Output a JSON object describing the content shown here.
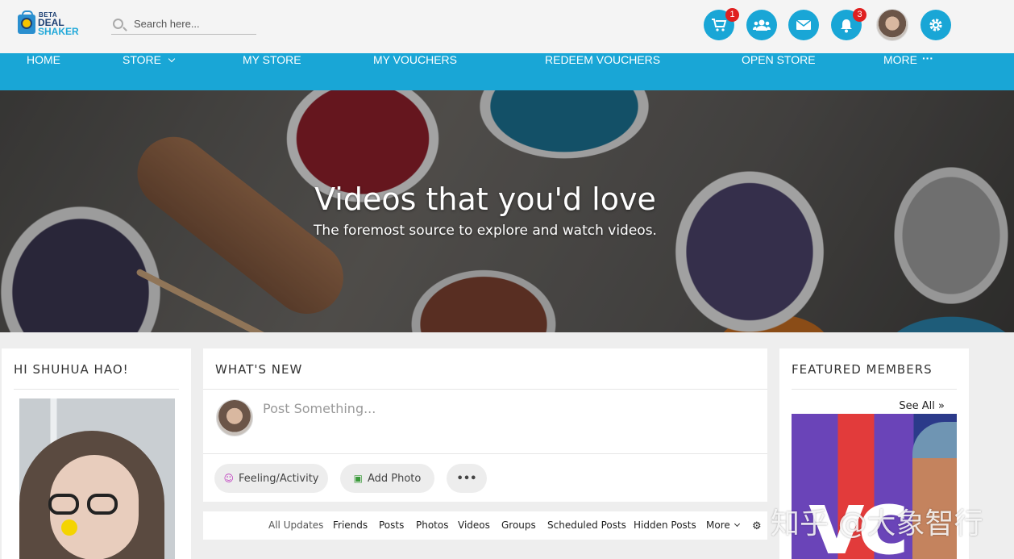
{
  "brand": {
    "line1": "BETA",
    "line2": "DEAL",
    "line3": "SHAKER"
  },
  "search": {
    "placeholder": "Search here..."
  },
  "header_icons": {
    "cart": {
      "icon": "cart-icon",
      "badge": "1"
    },
    "friends": {
      "icon": "users-icon"
    },
    "messages": {
      "icon": "envelope-icon"
    },
    "notifications": {
      "icon": "bell-icon",
      "badge": "3"
    },
    "settings": {
      "icon": "gear-icon"
    }
  },
  "nav": {
    "items": [
      "HOME",
      "STORE",
      "MY STORE",
      "MY VOUCHERS",
      "REDEEM VOUCHERS",
      "OPEN STORE",
      "MORE"
    ]
  },
  "hero": {
    "title": "Videos that you'd love",
    "subtitle": "The foremost source to explore and watch videos."
  },
  "left_panel": {
    "greeting": "HI SHUHUA HAO!"
  },
  "whats_new": {
    "title": "WHAT'S NEW",
    "post_placeholder": "Post Something...",
    "actions": [
      "Feeling/Activity",
      "Add Photo",
      "•••"
    ]
  },
  "feed_tabs": [
    "All Updates",
    "Friends",
    "Posts",
    "Photos",
    "Videos",
    "Groups",
    "Scheduled Posts",
    "Hidden Posts",
    "More"
  ],
  "featured": {
    "title": "FEATURED MEMBERS",
    "see_all": "See All"
  },
  "watermark": "知乎 @大象智行",
  "colors": {
    "accent": "#19a6d6",
    "badge": "#e02020"
  }
}
